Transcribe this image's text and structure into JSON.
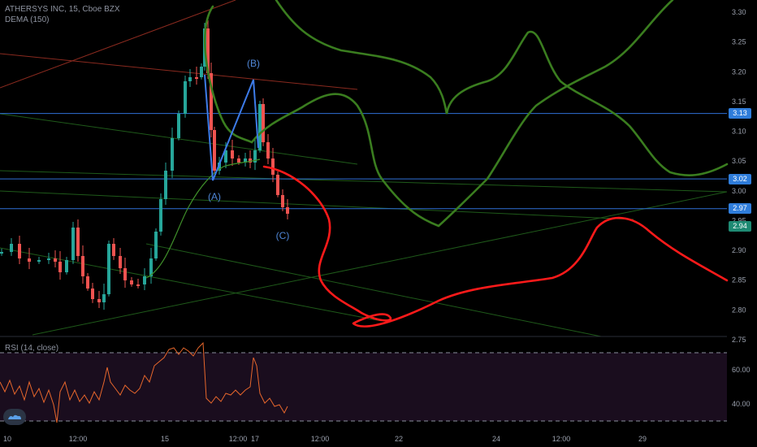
{
  "header": {
    "symbol_line": "ATHERSYS INC, 15, Cboe BZX",
    "indicator": "DEMA (150)",
    "rsi_label": "RSI (14, close)"
  },
  "colors": {
    "background": "#000000",
    "up_candle": "#26a69a",
    "down_candle": "#ef5350",
    "dema_line": "#3f8f2a",
    "hline": "#2f6fd6",
    "red_drawing": "#ff1a1a",
    "green_drawing": "#3a7d1f",
    "wave_line": "#3d7be8",
    "rsi_line": "#e8672c",
    "rsi_band": "#1a0d1e"
  },
  "price_tags": [
    {
      "label": "3.13",
      "value": 3.13,
      "color": "#2f7ddb"
    },
    {
      "label": "3.02",
      "value": 3.02,
      "color": "#2f7ddb"
    },
    {
      "label": "2.97",
      "value": 2.97,
      "color": "#2f7ddb"
    },
    {
      "label": "2.94",
      "value": 2.94,
      "color": "#1e8a73"
    }
  ],
  "wave_labels": [
    "(A)",
    "(B)",
    "(C)"
  ],
  "chart_data": [
    {
      "type": "candlestick",
      "title": "ATHERSYS INC, 15, Cboe BZX",
      "ylim": [
        2.7,
        3.32
      ],
      "y_axis_ticks": [
        "3.30",
        "3.25",
        "3.20",
        "3.15",
        "3.10",
        "3.05",
        "3.00",
        "2.95",
        "2.90",
        "2.85",
        "2.80",
        "2.75"
      ],
      "x_axis_ticks": [
        "10",
        "12:00",
        "15",
        "12:00",
        "17",
        "12:00",
        "22",
        "24",
        "12:00",
        "29"
      ],
      "grid": false,
      "last_price": 2.94,
      "horizontal_lines": [
        3.13,
        3.02,
        2.97
      ],
      "indicators": [
        {
          "name": "DEMA (150)"
        }
      ],
      "annotations": [
        "(A)",
        "(B)",
        "(C)"
      ]
    },
    {
      "type": "line",
      "title": "RSI (14, close)",
      "ylim": [
        25,
        72
      ],
      "y_axis_ticks": [
        "60.00",
        "40.00"
      ],
      "bands": [
        70,
        30
      ]
    }
  ]
}
